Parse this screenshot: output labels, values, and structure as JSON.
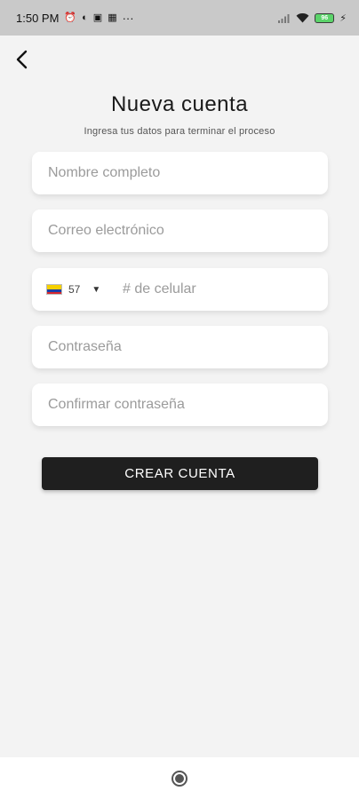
{
  "status_bar": {
    "time": "1:50 PM",
    "icons": [
      "alarm-icon",
      "vpn-icon",
      "cast-icon",
      "qr-icon"
    ],
    "overflow": "···",
    "battery_level": "96"
  },
  "header": {
    "back_icon": "chevron-left-icon",
    "title": "Nueva cuenta",
    "subtitle": "Ingresa tus datos para terminar el proceso"
  },
  "form": {
    "name_placeholder": "Nombre completo",
    "email_placeholder": "Correo electrónico",
    "phone": {
      "country_code": "57",
      "flag": "colombia-flag-icon",
      "placeholder": "# de celular"
    },
    "password_placeholder": "Contraseña",
    "confirm_password_placeholder": "Confirmar contraseña"
  },
  "actions": {
    "create_label": "CREAR CUENTA"
  },
  "colors": {
    "background": "#f3f3f3",
    "button": "#1f1f1f",
    "status_bar": "#c9c9c9"
  }
}
